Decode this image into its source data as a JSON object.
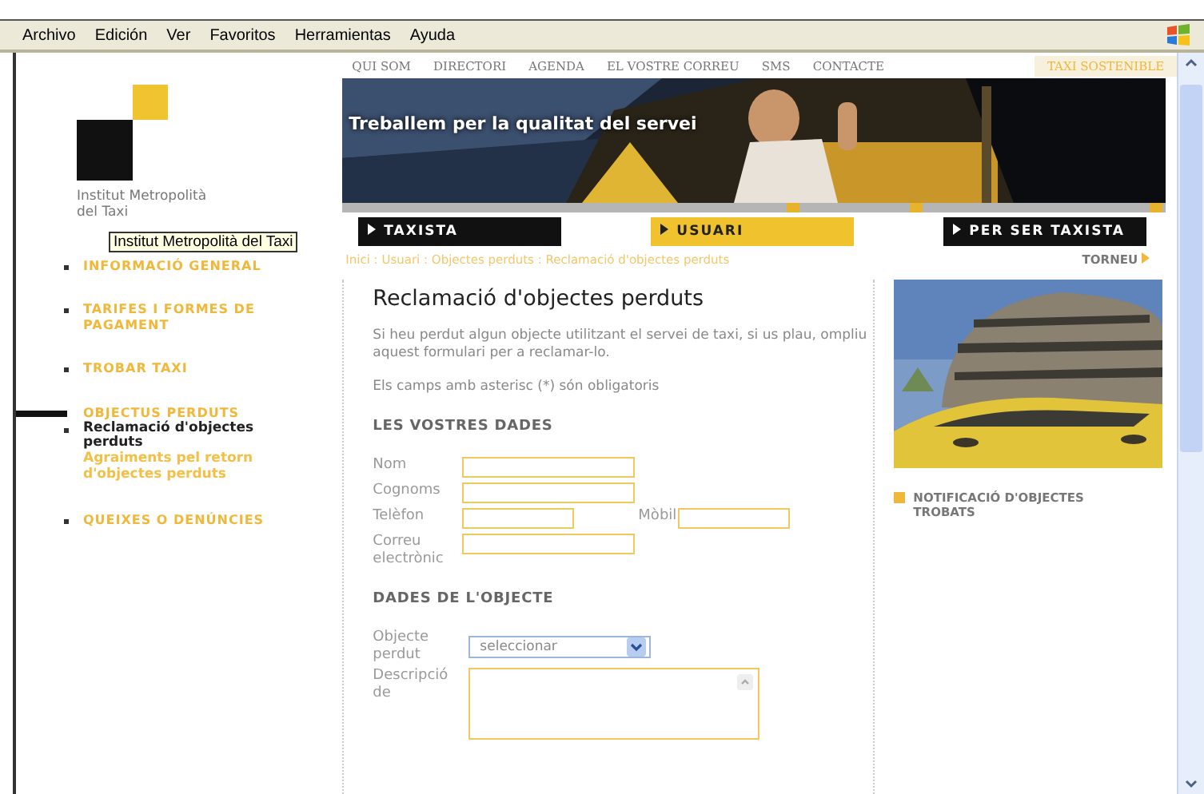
{
  "menu_bar": [
    "Archivo",
    "Edición",
    "Ver",
    "Favoritos",
    "Herramientas",
    "Ayuda"
  ],
  "logo": {
    "text": "Institut Metropolità del Taxi",
    "tooltip": "Institut Metropolità del Taxi"
  },
  "sidebar": {
    "items": [
      {
        "label": "INFORMACIÓ GENERAL",
        "selected": false
      },
      {
        "label": "TARIFES I FORMES DE PAGAMENT",
        "selected": false
      },
      {
        "label": "TROBAR TAXI",
        "selected": false
      },
      {
        "label": "OBJECTUS PERDUTS",
        "selected": true,
        "children": [
          {
            "label": "Reclamació d'objectes perduts",
            "selected": true
          },
          {
            "label": "Agraiments pel retorn d'objectes perduts",
            "selected": false
          }
        ]
      },
      {
        "label": "QUEIXES O DENÚNCIES",
        "selected": false
      }
    ]
  },
  "top_nav": [
    {
      "label": "QUI SOM",
      "kind": "link"
    },
    {
      "label": "DIRECTORI",
      "kind": "link"
    },
    {
      "label": "AGENDA",
      "kind": "link"
    },
    {
      "label": "EL VOSTRE CORREU",
      "kind": "link"
    },
    {
      "label": "SMS",
      "kind": "link"
    },
    {
      "label": "CONTACTE",
      "kind": "link"
    },
    {
      "label": "TAXI SOSTENIBLE",
      "kind": "featured"
    }
  ],
  "banner": {
    "headline": "Treballem per la qualitat del servei"
  },
  "tabs": [
    {
      "label": "TAXISTA",
      "selected": false
    },
    {
      "label": "USUARI",
      "selected": true
    },
    {
      "label": "PER SER TAXISTA",
      "selected": false
    }
  ],
  "breadcrumb": "Inici : Usuari : Objectes perduts : Reclamació d'objectes perduts",
  "back_link": "TORNEU",
  "page_title": "Reclamació d'objectes perduts",
  "intro": "Si heu perdut algun objecte utilitzant el servei de taxi, si us plau, ompliu aquest formulari per a reclamar-lo.",
  "required_note": "Els camps amb asterisc (*) són obligatoris",
  "sections": [
    {
      "heading": "LES VOSTRES DADES",
      "rows": [
        [
          {
            "label": "Nom",
            "kind": "text"
          }
        ],
        [
          {
            "label": "Cognoms",
            "kind": "text"
          }
        ],
        [
          {
            "label": "Telèfon",
            "kind": "short"
          },
          {
            "label": "Mòbil",
            "kind": "short"
          }
        ],
        [
          {
            "label": "Correu electrònic",
            "kind": "text"
          }
        ]
      ]
    },
    {
      "heading": "DADES DE L'OBJECTE",
      "rows": [
        [
          {
            "label": "Objecte perdut",
            "kind": "select",
            "value": "seleccionar"
          }
        ],
        [
          {
            "label": "Descripció de",
            "kind": "textarea"
          }
        ]
      ]
    }
  ],
  "side_panel": {
    "link": "NOTIFICACIÓ D'OBJECTES TROBATS"
  }
}
